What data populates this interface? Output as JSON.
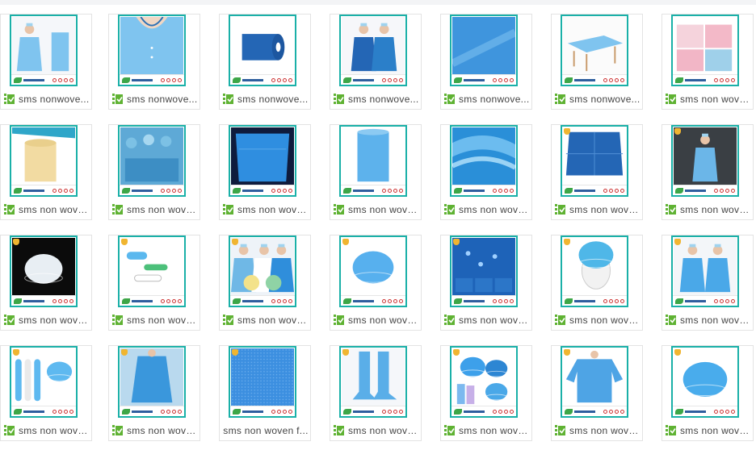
{
  "colors": {
    "frame": "#1ab0a8",
    "check": "#5fb233",
    "badge": "#f0b530",
    "caption": "#444444"
  },
  "rows": [
    [
      {
        "caption": "sms nonwove...",
        "thumb": "gown-man",
        "badge": false
      },
      {
        "caption": "sms nonwove...",
        "thumb": "gown-neck",
        "badge": false
      },
      {
        "caption": "sms nonwove...",
        "thumb": "roll-blue",
        "badge": false
      },
      {
        "caption": "sms nonwove...",
        "thumb": "gown-couple",
        "badge": false
      },
      {
        "caption": "sms nonwove...",
        "thumb": "fabric-blue",
        "badge": false
      },
      {
        "caption": "sms nonwove...",
        "thumb": "table-sheet",
        "badge": false
      },
      {
        "caption": "sms non wove...",
        "thumb": "rolls-pastel",
        "badge": false
      }
    ],
    [
      {
        "caption": "sms non wove...",
        "thumb": "roll-yellow",
        "badge": false
      },
      {
        "caption": "sms non wove...",
        "thumb": "surgery-team",
        "badge": false
      },
      {
        "caption": "sms non wove...",
        "thumb": "blue-drape",
        "badge": false
      },
      {
        "caption": "sms non wove...",
        "thumb": "roll-lightblue",
        "badge": false
      },
      {
        "caption": "sms non wove...",
        "thumb": "fabric-layers",
        "badge": false
      },
      {
        "caption": "sms non wove...",
        "thumb": "drape-sheet",
        "badge": true
      },
      {
        "caption": "sms non wove...",
        "thumb": "gown-dark",
        "badge": true
      }
    ],
    [
      {
        "caption": "sms non wove...",
        "thumb": "cap-white-black",
        "badge": true
      },
      {
        "caption": "sms non wove...",
        "thumb": "caps-colored",
        "badge": true
      },
      {
        "caption": "sms non wove...",
        "thumb": "collage",
        "badge": true
      },
      {
        "caption": "sms non wove...",
        "thumb": "cap-blue",
        "badge": true
      },
      {
        "caption": "sms non wove...",
        "thumb": "fabric-drops",
        "badge": true
      },
      {
        "caption": "sms non wove...",
        "thumb": "cap-mannequin",
        "badge": true
      },
      {
        "caption": "sms non wove...",
        "thumb": "gowns-two",
        "badge": true
      }
    ],
    [
      {
        "caption": "sms non wove...",
        "thumb": "caps-stack",
        "badge": true
      },
      {
        "caption": "sms non wove...",
        "thumb": "gown-back",
        "badge": true
      },
      {
        "caption": "sms non woven f...",
        "thumb": "fabric-texture",
        "badge": true,
        "no_check": true
      },
      {
        "caption": "sms non wove...",
        "thumb": "boot-covers",
        "badge": true
      },
      {
        "caption": "sms non wove...",
        "thumb": "caps-assorted",
        "badge": true
      },
      {
        "caption": "sms non wove...",
        "thumb": "gown-front",
        "badge": true
      },
      {
        "caption": "sms non wove...",
        "thumb": "cap-single",
        "badge": true
      }
    ]
  ]
}
